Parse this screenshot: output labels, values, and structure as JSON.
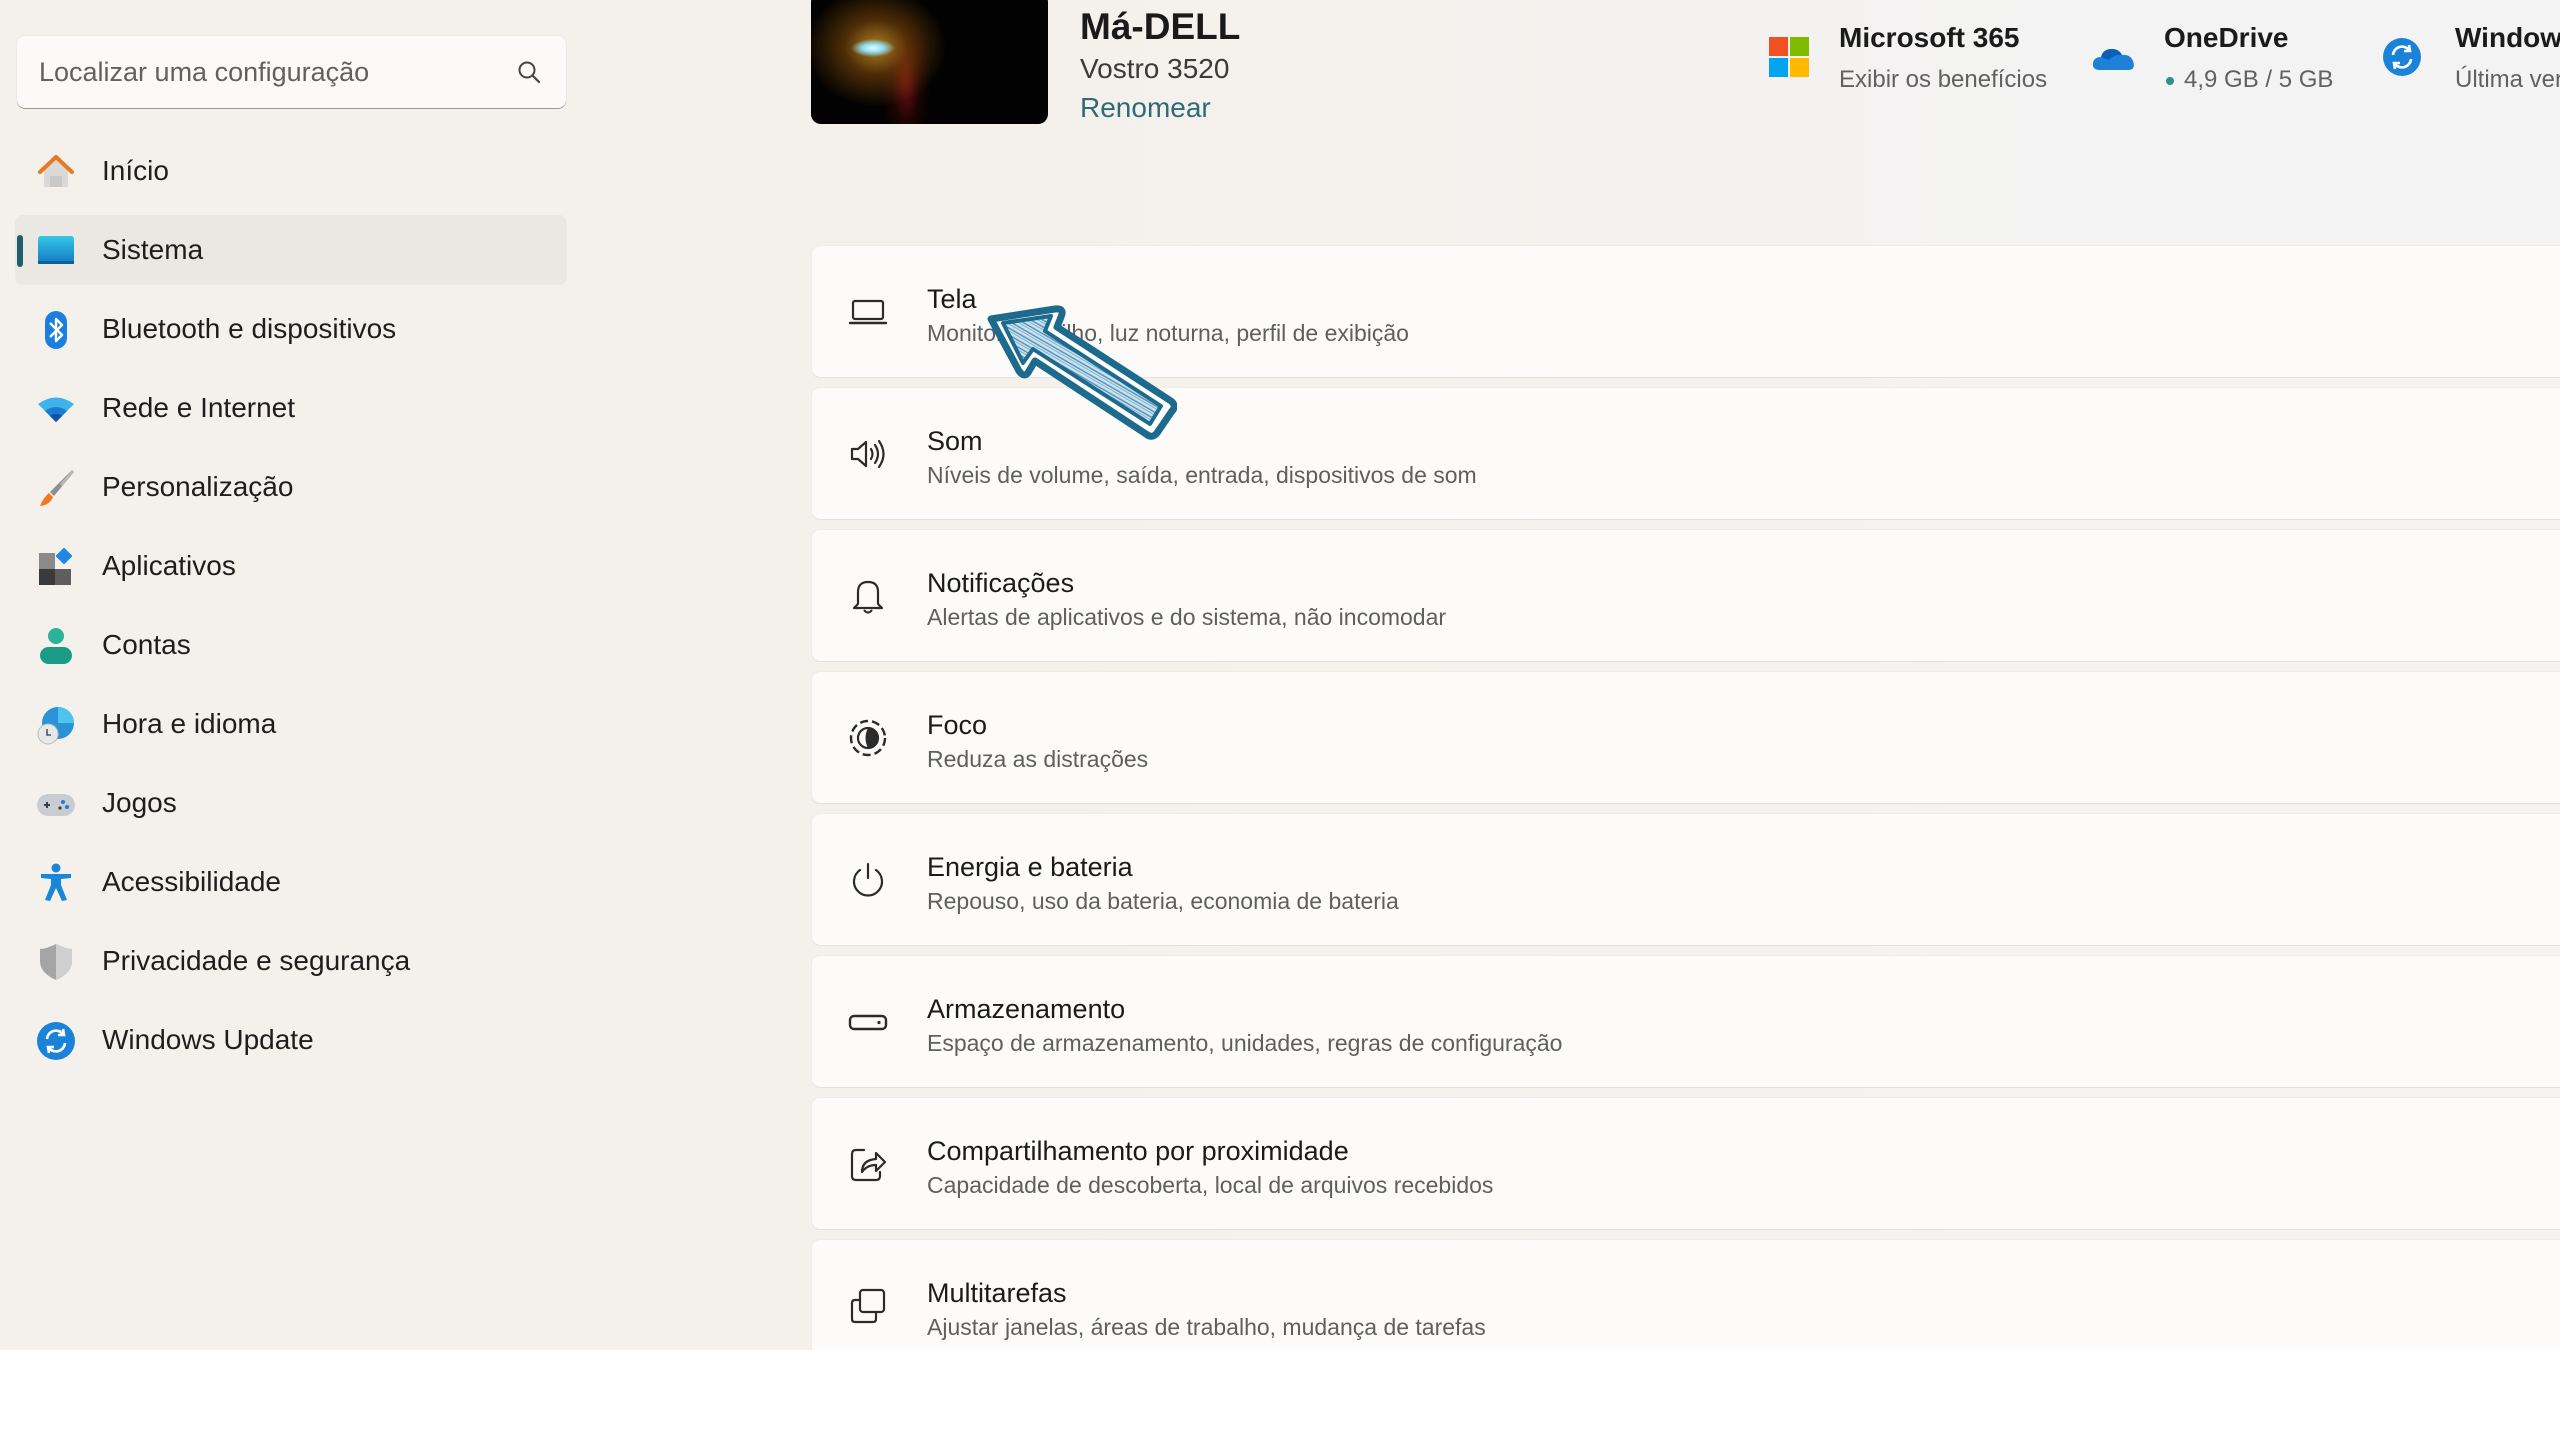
{
  "sidebar": {
    "search": {
      "placeholder": "Localizar uma configuração",
      "value": ""
    },
    "items": [
      {
        "label": "Início",
        "icon": "home-icon",
        "selected": false
      },
      {
        "label": "Sistema",
        "icon": "system-icon",
        "selected": true
      },
      {
        "label": "Bluetooth e dispositivos",
        "icon": "bluetooth-icon",
        "selected": false
      },
      {
        "label": "Rede e Internet",
        "icon": "wifi-icon",
        "selected": false
      },
      {
        "label": "Personalização",
        "icon": "paintbrush-icon",
        "selected": false
      },
      {
        "label": "Aplicativos",
        "icon": "apps-icon",
        "selected": false
      },
      {
        "label": "Contas",
        "icon": "account-icon",
        "selected": false
      },
      {
        "label": "Hora e idioma",
        "icon": "time-language-icon",
        "selected": false
      },
      {
        "label": "Jogos",
        "icon": "gamepad-icon",
        "selected": false
      },
      {
        "label": "Acessibilidade",
        "icon": "accessibility-icon",
        "selected": false
      },
      {
        "label": "Privacidade e segurança",
        "icon": "shield-icon",
        "selected": false
      },
      {
        "label": "Windows Update",
        "icon": "windows-update-icon",
        "selected": false
      }
    ]
  },
  "header": {
    "device_name": "Má-DELL",
    "device_model": "Vostro 3520",
    "rename_label": "Renomear",
    "tiles": [
      {
        "title": "Microsoft 365",
        "subtitle": "Exibir os benefícios",
        "icon": "microsoft-logo-icon"
      },
      {
        "title": "OneDrive",
        "subtitle": "4,9 GB / 5 GB",
        "icon": "onedrive-cloud-icon",
        "status_color": "#2f8f8a"
      },
      {
        "title": "Window",
        "subtitle": "Última ver",
        "icon": "windows-update-icon"
      }
    ]
  },
  "main": {
    "cards": [
      {
        "title": "Tela",
        "subtitle": "Monitores, brilho, luz noturna, perfil de exibição",
        "icon": "display-icon"
      },
      {
        "title": "Som",
        "subtitle": "Níveis de volume, saída, entrada, dispositivos de som",
        "icon": "speaker-icon"
      },
      {
        "title": "Notificações",
        "subtitle": "Alertas de aplicativos e do sistema, não incomodar",
        "icon": "bell-icon"
      },
      {
        "title": "Foco",
        "subtitle": "Reduza as distrações",
        "icon": "focus-icon"
      },
      {
        "title": "Energia e bateria",
        "subtitle": "Repouso, uso da bateria, economia de bateria",
        "icon": "power-icon"
      },
      {
        "title": "Armazenamento",
        "subtitle": "Espaço de armazenamento, unidades, regras de configuração",
        "icon": "storage-icon"
      },
      {
        "title": "Compartilhamento por proximidade",
        "subtitle": "Capacidade de descoberta, local de arquivos recebidos",
        "icon": "share-icon"
      },
      {
        "title": "Multitarefas",
        "subtitle": "Ajustar janelas, áreas de trabalho, mudança de tarefas",
        "icon": "multitasking-icon"
      }
    ]
  },
  "overlay": {
    "cursor": "hand-drawn-arrow-cursor-icon",
    "color": "#1d6a8c"
  },
  "colors": {
    "accent": "#1f5f6b",
    "link": "#2d6b7a",
    "selected_bg": "#ebe7e3"
  }
}
